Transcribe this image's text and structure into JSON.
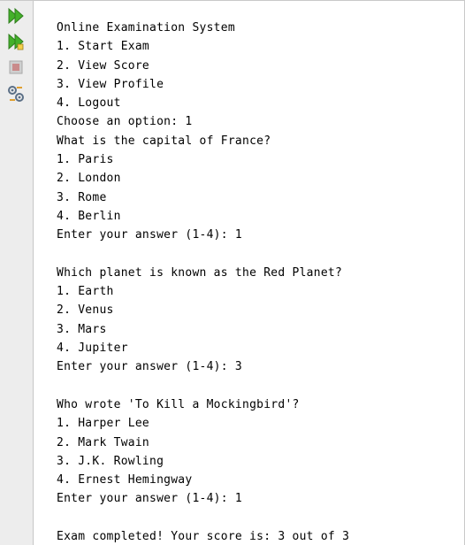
{
  "toolbar": {
    "buttons": [
      {
        "icon": "rerun-icon",
        "color": "#3cab2f"
      },
      {
        "icon": "rerun-with-options-icon",
        "color": "#3cab2f"
      },
      {
        "icon": "stop-icon",
        "color": "#c0504d"
      },
      {
        "icon": "settings-icon",
        "color": "#6c7a89"
      }
    ]
  },
  "console": {
    "lines": [
      "Online Examination System",
      "1. Start Exam",
      "2. View Score",
      "3. View Profile",
      "4. Logout",
      "Choose an option: 1",
      "What is the capital of France?",
      "1. Paris",
      "2. London",
      "3. Rome",
      "4. Berlin",
      "Enter your answer (1-4): 1",
      "",
      "Which planet is known as the Red Planet?",
      "1. Earth",
      "2. Venus",
      "3. Mars",
      "4. Jupiter",
      "Enter your answer (1-4): 3",
      "",
      "Who wrote 'To Kill a Mockingbird'?",
      "1. Harper Lee",
      "2. Mark Twain",
      "3. J.K. Rowling",
      "4. Ernest Hemingway",
      "Enter your answer (1-4): 1",
      "",
      "Exam completed! Your score is: 3 out of 3"
    ]
  }
}
